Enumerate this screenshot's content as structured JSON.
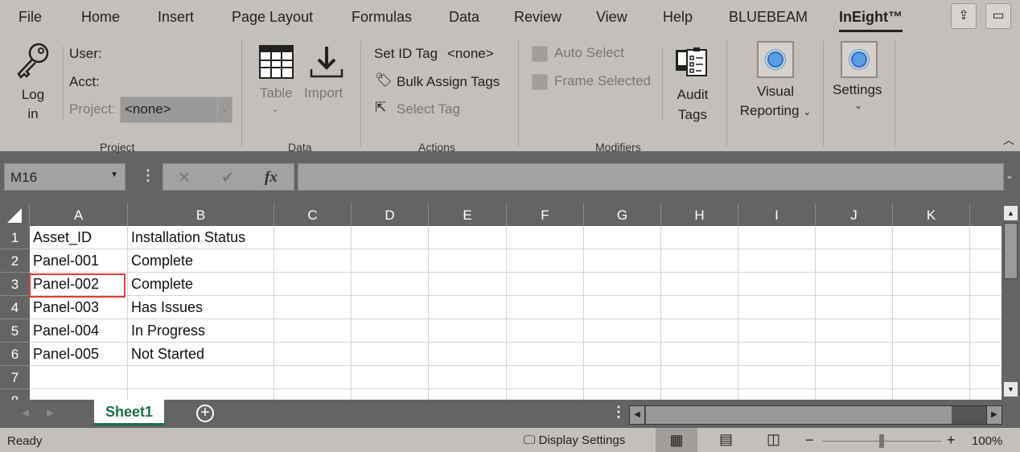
{
  "menu_tabs": [
    "File",
    "Home",
    "Insert",
    "Page Layout",
    "Formulas",
    "Data",
    "Review",
    "View",
    "Help",
    "BLUEBEAM",
    "InEight™"
  ],
  "active_tab": "InEight™",
  "ribbon": {
    "project": {
      "login": "Log in",
      "user": "User:",
      "acct": "Acct:",
      "project_label": "Project:",
      "project_value": "<none>",
      "group": "Project"
    },
    "data": {
      "table": "Table",
      "import": "Import",
      "group": "Data"
    },
    "actions": {
      "set_id_tag": "Set ID Tag",
      "set_id_value": "<none>",
      "bulk_assign": "Bulk Assign Tags",
      "select_tag": "Select Tag",
      "group": "Actions"
    },
    "modifiers": {
      "auto_select": "Auto Select",
      "frame_selected": "Frame Selected",
      "audit_tags": "Audit Tags",
      "group": "Modifiers"
    },
    "visual_reporting": "Visual Reporting",
    "settings": "Settings"
  },
  "formula_bar": {
    "name_box": "M16",
    "fx": "fx",
    "value": ""
  },
  "columns": [
    "A",
    "B",
    "C",
    "D",
    "E",
    "F",
    "G",
    "H",
    "I",
    "J",
    "K"
  ],
  "rows": [
    [
      "Asset_ID",
      "Installation Status"
    ],
    [
      "Panel-001",
      "Complete"
    ],
    [
      "Panel-002",
      "Complete"
    ],
    [
      "Panel-003",
      "Has Issues"
    ],
    [
      "Panel-004",
      "In Progress"
    ],
    [
      "Panel-005",
      "Not Started"
    ],
    [
      "",
      ""
    ],
    [
      "",
      ""
    ]
  ],
  "selected_cell": "A3",
  "sheet_tabs": [
    "Sheet1"
  ],
  "status": {
    "ready": "Ready",
    "display_settings": "Display Settings",
    "zoom": "100%"
  },
  "colors": {
    "accent_green": "#1e7145",
    "selection": "#e03c3c",
    "visual_dot": "#5a9ee0"
  }
}
